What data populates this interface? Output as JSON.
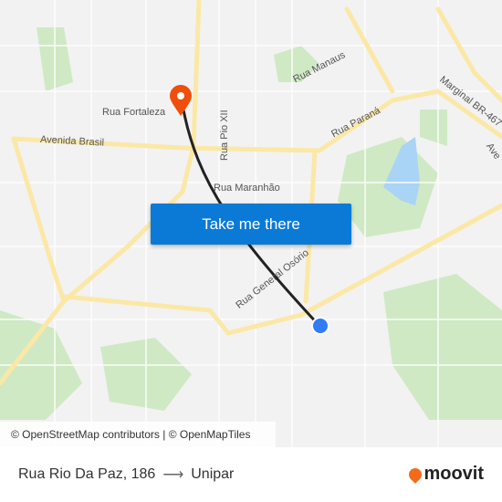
{
  "map": {
    "labels": [
      {
        "text": "Rua Manaus"
      },
      {
        "text": "Marginal BR-467"
      },
      {
        "text": "Rua Fortaleza"
      },
      {
        "text": "Rua Pio XII"
      },
      {
        "text": "Rua Paraná"
      },
      {
        "text": "Avenida Brasil"
      },
      {
        "text": "Rua Maranhão"
      },
      {
        "text": "Rua General Osório"
      },
      {
        "text": "Ave"
      }
    ],
    "route_color": "#222222",
    "origin_color": "#2f7cf6",
    "destination_color": "#f04e0c",
    "action_button": "Take me there",
    "attribution": "© OpenStreetMap contributors | © OpenMapTiles"
  },
  "footer": {
    "origin": "Rua Rio Da Paz, 186",
    "arrow": "⟶",
    "destination": "Unipar",
    "brand": "moovit"
  }
}
